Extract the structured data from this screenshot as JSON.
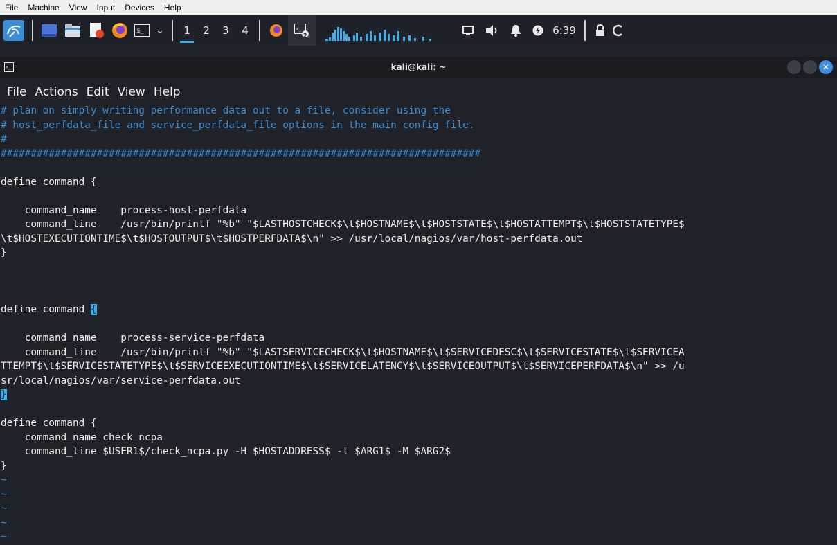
{
  "vm_menubar": {
    "items": [
      "File",
      "Machine",
      "View",
      "Input",
      "Devices",
      "Help"
    ]
  },
  "panel": {
    "workspaces": [
      "1",
      "2",
      "3",
      "4"
    ],
    "active_workspace": "1",
    "clock": "6:39",
    "terminal_badge": "2",
    "icons": [
      "kali-menu-icon",
      "show-desktop-icon",
      "file-manager-icon",
      "text-editor-icon",
      "firefox-icon",
      "terminal-icon",
      "terminal-dropdown-icon",
      "firefox-task-icon",
      "terminal-task-icon",
      "network-icon",
      "volume-icon",
      "notifications-icon",
      "power-manager-icon",
      "lock-icon",
      "logout-icon"
    ],
    "accent_color": "#3daee9"
  },
  "window": {
    "title": "kali@kali: ~",
    "menu": [
      "File",
      "Actions",
      "Edit",
      "View",
      "Help"
    ]
  },
  "editor": {
    "comment_lines": [
      "# plan on simply writing performance data out to a file, consider using the",
      "# host_perfdata_file and service_perfdata_file options in the main config file.",
      "#",
      "################################################################################"
    ],
    "block1": {
      "define": "define command {",
      "name_line": "    command_name    process-host-perfdata",
      "cmd_line_1": "    command_line    /usr/bin/printf \"%b\" \"$LASTHOSTCHECK$\\t$HOSTNAME$\\t$HOSTSTATE$\\t$HOSTATTEMPT$\\t$HOSTSTATETYPE$",
      "cmd_line_2": "\\t$HOSTEXECUTIONTIME$\\t$HOSTOUTPUT$\\t$HOSTPERFDATA$\\n\" >> /usr/local/nagios/var/host-perfdata.out",
      "close": "}"
    },
    "block2": {
      "define_prefix": "define command ",
      "define_brace": "{",
      "name_line": "    command_name    process-service-perfdata",
      "cmd_line_1": "    command_line    /usr/bin/printf \"%b\" \"$LASTSERVICECHECK$\\t$HOSTNAME$\\t$SERVICEDESC$\\t$SERVICESTATE$\\t$SERVICEA",
      "cmd_line_2": "TTEMPT$\\t$SERVICESTATETYPE$\\t$SERVICEEXECUTIONTIME$\\t$SERVICELATENCY$\\t$SERVICEOUTPUT$\\t$SERVICEPERFDATA$\\n\" >> /u",
      "cmd_line_3": "sr/local/nagios/var/service-perfdata.out",
      "close": "}"
    },
    "block3": {
      "define": "define command {",
      "name_line": "    command_name check_ncpa",
      "cmd_line": "    command_line $USER1$/check_ncpa.py -H $HOSTADDRESS$ -t $ARG1$ -M $ARG2$",
      "close": "}"
    },
    "tilde": "~"
  }
}
